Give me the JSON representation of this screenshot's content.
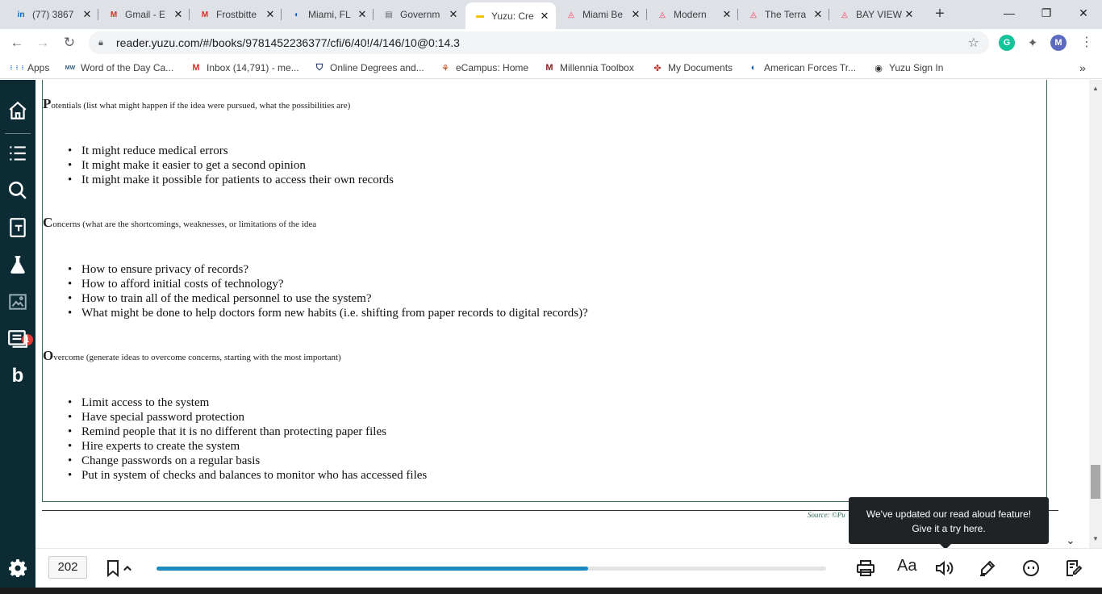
{
  "tabs": [
    {
      "title": "(77) 3867",
      "icon": "linkedin-icon",
      "fav": "in",
      "color": "#0a66c2"
    },
    {
      "title": "Gmail - E",
      "icon": "gmail-icon",
      "fav": "M",
      "color": "#d93025"
    },
    {
      "title": "Frostbitte",
      "icon": "gmail-icon",
      "fav": "M",
      "color": "#d93025"
    },
    {
      "title": "Miami, FL",
      "icon": "globe-icon",
      "fav": "◐",
      "color": "#1a5fb4"
    },
    {
      "title": "Governm",
      "icon": "document-icon",
      "fav": "▤",
      "color": "#5f6368"
    },
    {
      "title": "Yuzu: Cre",
      "icon": "yuzu-icon",
      "fav": "▬",
      "color": "#f5c400"
    },
    {
      "title": "Miami Be",
      "icon": "airbnb-icon",
      "fav": "◬",
      "color": "#ff385c"
    },
    {
      "title": "Modern",
      "icon": "airbnb-icon",
      "fav": "◬",
      "color": "#ff385c"
    },
    {
      "title": "The Terra",
      "icon": "airbnb-icon",
      "fav": "◬",
      "color": "#ff385c"
    },
    {
      "title": "BAY VIEW",
      "icon": "airbnb-icon",
      "fav": "◬",
      "color": "#ff385c"
    }
  ],
  "active_tab": 5,
  "window": {
    "minimize": "—",
    "maximize": "❐",
    "close": "✕"
  },
  "url": "reader.yuzu.com/#/books/9781452236377/cfi/6/40!/4/146/10@0:14.3",
  "extensions": [
    {
      "name": "grammarly-icon",
      "label": "G",
      "color": "#15c39a"
    },
    {
      "name": "puzzle-icon",
      "label": "✦",
      "color": "#5f6368"
    },
    {
      "name": "profile-avatar",
      "label": "M",
      "color": "#5c6bc0"
    }
  ],
  "bookmarks": [
    {
      "label": "Apps",
      "icon": "apps-grid-icon",
      "glyph": "⋮⋮⋮",
      "color": "#1a73e8"
    },
    {
      "label": "Word of the Day Ca...",
      "icon": "merriam-webster-icon",
      "glyph": "MW",
      "color": "#305f7a"
    },
    {
      "label": "Inbox (14,791) - me...",
      "icon": "gmail-icon",
      "glyph": "M",
      "color": "#d93025"
    },
    {
      "label": "Online Degrees and...",
      "icon": "shield-icon",
      "glyph": "⛉",
      "color": "#1c2a5c"
    },
    {
      "label": "eCampus: Home",
      "icon": "ecampus-icon",
      "glyph": "⚘",
      "color": "#b7410e"
    },
    {
      "label": "Millennia Toolbox",
      "icon": "millennia-icon",
      "glyph": "M",
      "color": "#8b1a1a"
    },
    {
      "label": "My Documents",
      "icon": "documents-icon",
      "glyph": "✤",
      "color": "#c0392b"
    },
    {
      "label": "American Forces Tr...",
      "icon": "globe-icon",
      "glyph": "◐",
      "color": "#1a5fb4"
    },
    {
      "label": "Yuzu Sign In",
      "icon": "yuzu-signin-icon",
      "glyph": "◉",
      "color": "#333333"
    }
  ],
  "bookmarks_more": "»",
  "sidebar": {
    "lab_badge": "1",
    "logo_letter": "b"
  },
  "sections": [
    {
      "cap": "P",
      "heading": "otentials (list what might happen if the idea were pursued, what the possibilities are)",
      "items": [
        "It might reduce medical errors",
        "It might make it easier to get a second opinion",
        "It might make it possible for patients to access their own records"
      ]
    },
    {
      "cap": "C",
      "heading": "oncerns (what are the shortcomings, weaknesses, or limitations of the idea",
      "items": [
        "How to ensure privacy of records?",
        "How to afford initial costs of technology?",
        "How to train all of the medical personnel to use the system?",
        "What might be done to help doctors form new habits (i.e. shifting from paper records to digital records)?"
      ]
    },
    {
      "cap": "O",
      "heading": "vercome (generate ideas to overcome concerns, starting with the most important)",
      "items": [
        "Limit access to the system",
        "Have special password protection",
        "Remind people that it is no different than protecting paper files",
        "Hire experts to create the system",
        "Change passwords on a regular basis",
        "Put in system of checks and balances to monitor who has accessed files"
      ]
    }
  ],
  "source_text": "Source: ©Pu",
  "tooltip": {
    "line1": "We've updated our read aloud feature!",
    "line2": "Give it a try here."
  },
  "bottombar": {
    "page": "202",
    "progress": 0.645,
    "font_label": "Aa"
  },
  "colors": {
    "sidebar": "#0d2b35",
    "progress": "#1f8ac2",
    "box_border": "#2e6b5a"
  }
}
